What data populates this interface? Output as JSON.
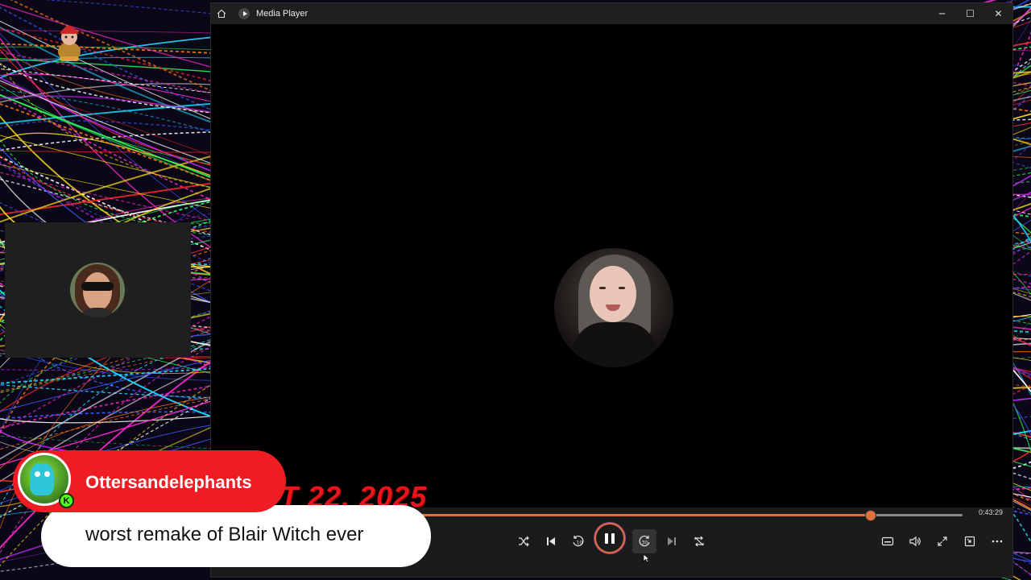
{
  "window": {
    "title": "Media Player",
    "minimize_glyph": "─",
    "maximize_glyph": "☐",
    "close_glyph": "✕"
  },
  "video": {
    "overlay_text": "T 22, 2025"
  },
  "playback": {
    "progress_fraction": 0.84,
    "time_remaining": "0:43:29"
  },
  "controls": {
    "icons": [
      "home-icon",
      "shuffle-icon",
      "previous-icon",
      "rewind-10-icon",
      "pause-icon",
      "forward-30-icon",
      "next-icon",
      "repeat-icon",
      "captions-icon",
      "volume-icon",
      "fullscreen-icon",
      "mini-player-icon",
      "more-options-icon"
    ]
  },
  "chat_alert": {
    "username": "Ottersandelephants",
    "message": "worst remake of Blair Witch ever",
    "platform_badge": "K",
    "accent_color": "#ef1c24",
    "badge_color": "#53fc18"
  },
  "colors": {
    "seek_accent": "#e0703c",
    "titlebar": "#1f1f1f",
    "controls_bg": "#1b1b1b"
  }
}
